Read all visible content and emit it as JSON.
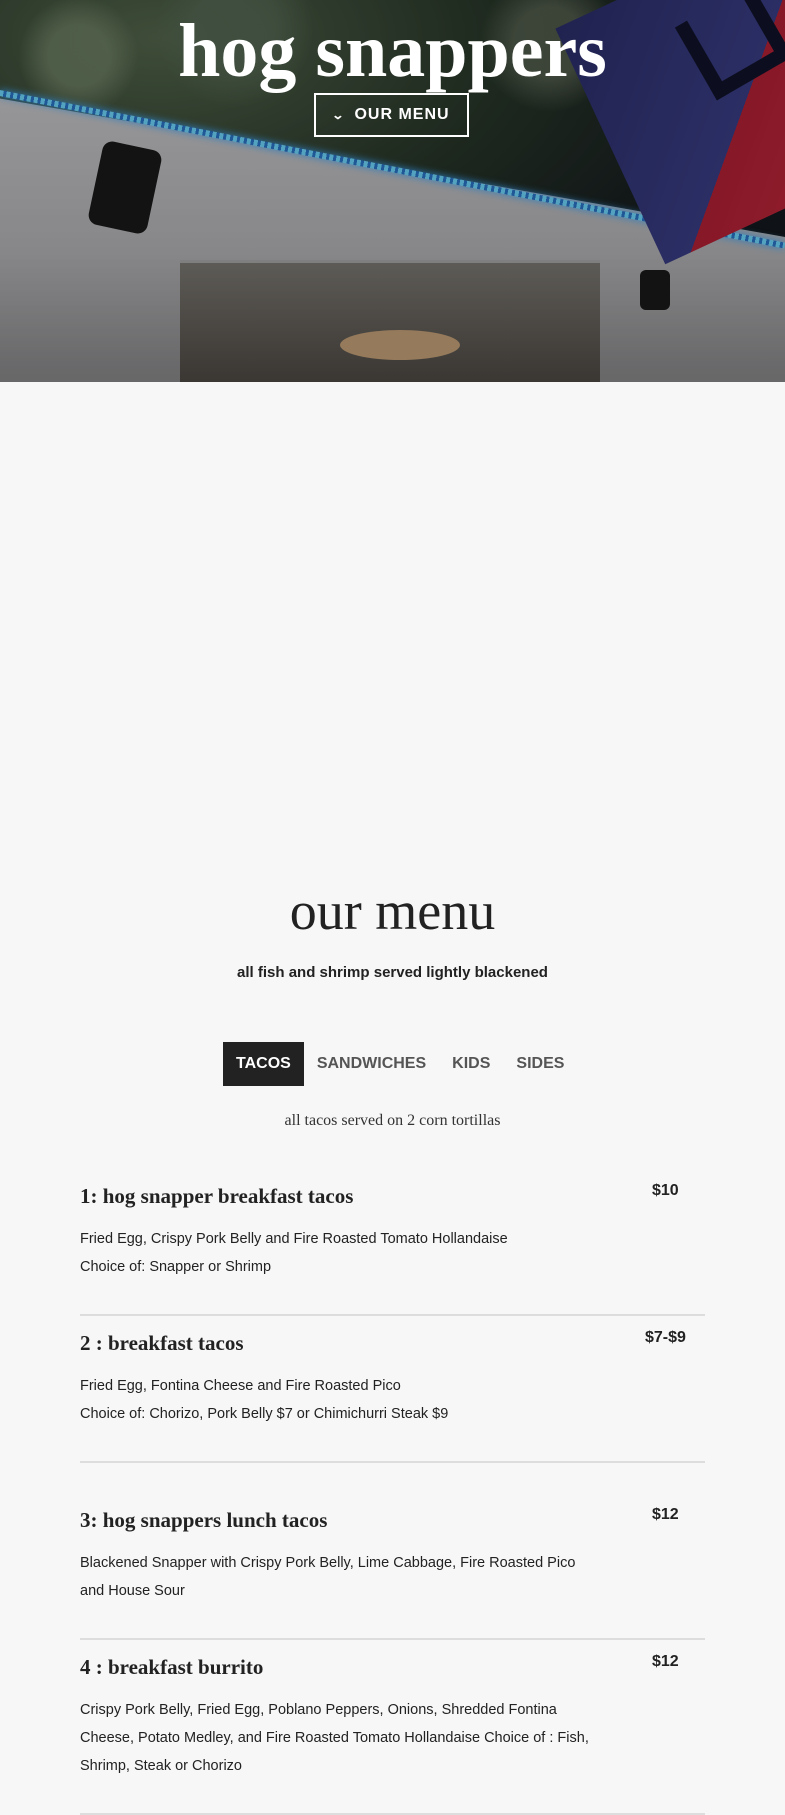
{
  "hero": {
    "title": "hog snappers",
    "menu_button": "OUR MENU"
  },
  "menu": {
    "title": "our menu",
    "subtitle": "all fish and shrimp served lightly blackened",
    "tabs": [
      {
        "label": "TACOS",
        "active": true
      },
      {
        "label": "SANDWICHES",
        "active": false
      },
      {
        "label": "KIDS",
        "active": false
      },
      {
        "label": "SIDES",
        "active": false
      }
    ],
    "note": "all tacos served on 2 corn tortillas",
    "items": [
      {
        "name": "1: hog snapper breakfast tacos",
        "price": "$10",
        "desc": [
          "Fried Egg, Crispy Pork Belly and Fire Roasted Tomato Hollandaise",
          "Choice of: Snapper or Shrimp"
        ]
      },
      {
        "name": "2 : breakfast tacos",
        "price": "$7-$9",
        "desc": [
          "Fried Egg, Fontina Cheese and Fire Roasted Pico",
          "Choice of: Chorizo, Pork Belly $7 or Chimichurri Steak $9"
        ]
      },
      {
        "name": "3: hog snappers lunch tacos",
        "price": "$12",
        "desc": [
          "Blackened Snapper with Crispy Pork Belly, Lime Cabbage, Fire Roasted Pico and House Sour"
        ]
      },
      {
        "name": "4 : breakfast burrito",
        "price": "$12",
        "desc": [
          "Crispy Pork Belly, Fried Egg, Poblano Peppers, Onions, Shredded Fontina Cheese, Potato Medley, and Fire Roasted Tomato Hollandaise Choice of : Fish, Shrimp, Steak or Chorizo"
        ]
      }
    ]
  },
  "icons": {
    "menu_button_icon": "chevron-down-icon"
  }
}
